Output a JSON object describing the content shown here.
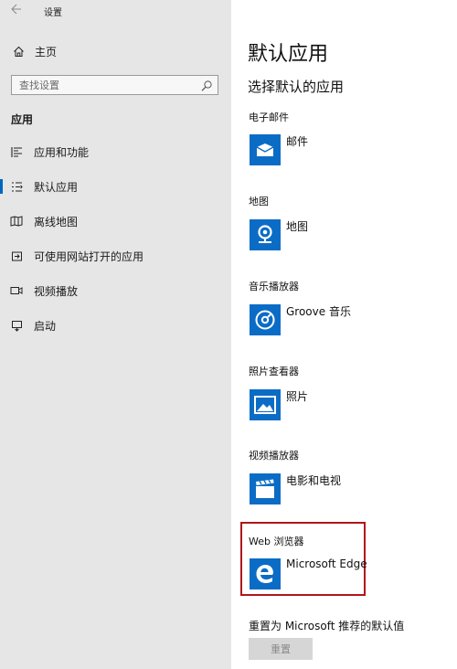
{
  "window": {
    "title": "设置",
    "back_icon": "back-arrow-icon"
  },
  "sidebar": {
    "home_label": "主页",
    "search": {
      "placeholder": "查找设置",
      "value": ""
    },
    "section_label": "应用",
    "items": [
      {
        "label": "应用和功能",
        "icon": "list-icon",
        "active": false
      },
      {
        "label": "默认应用",
        "icon": "default-apps-icon",
        "active": true
      },
      {
        "label": "离线地图",
        "icon": "offline-map-icon",
        "active": false
      },
      {
        "label": "可使用网站打开的应用",
        "icon": "web-app-icon",
        "active": false
      },
      {
        "label": "视频播放",
        "icon": "video-icon",
        "active": false
      },
      {
        "label": "启动",
        "icon": "startup-icon",
        "active": false
      }
    ]
  },
  "main": {
    "title": "默认应用",
    "subtitle": "选择默认的应用",
    "categories": [
      {
        "label": "电子邮件",
        "app": "邮件",
        "icon": "mail-icon"
      },
      {
        "label": "地图",
        "app": "地图",
        "icon": "maps-icon"
      },
      {
        "label": "音乐播放器",
        "app": "Groove 音乐",
        "icon": "groove-music-icon"
      },
      {
        "label": "照片查看器",
        "app": "照片",
        "icon": "photos-icon"
      },
      {
        "label": "视频播放器",
        "app": "电影和电视",
        "icon": "movies-tv-icon"
      },
      {
        "label": "Web 浏览器",
        "app": "Microsoft Edge",
        "icon": "edge-icon"
      }
    ],
    "reset_label": "重置为 Microsoft 推荐的默认值",
    "reset_button": "重置"
  },
  "colors": {
    "accent": "#0067c0",
    "tile": "#0b6cc6",
    "sidebar_bg": "#e6e6e6",
    "highlight": "#b0151b"
  }
}
